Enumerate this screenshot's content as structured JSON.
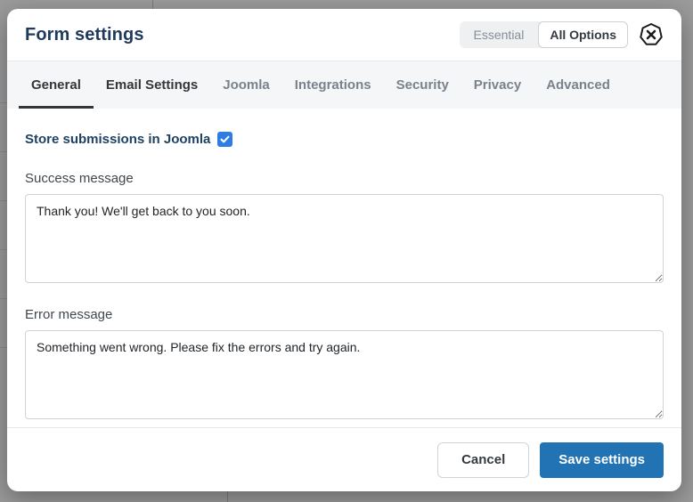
{
  "colors": {
    "accent_blue": "#2173b4",
    "checkbox_blue": "#2e7ce4",
    "title_navy": "#1f3a5c",
    "backdrop_gray": "#9b9b9b"
  },
  "modal": {
    "title": "Form settings",
    "mode_toggle": {
      "essential_label": "Essential",
      "all_options_label": "All Options",
      "selected": "All Options"
    },
    "logo_icon": "x-heptagon-icon",
    "tabs": [
      {
        "label": "General",
        "state": "active"
      },
      {
        "label": "Email Settings",
        "state": "emphasized"
      },
      {
        "label": "Joomla",
        "state": "normal"
      },
      {
        "label": "Integrations",
        "state": "normal"
      },
      {
        "label": "Security",
        "state": "normal"
      },
      {
        "label": "Privacy",
        "state": "normal"
      },
      {
        "label": "Advanced",
        "state": "normal"
      }
    ],
    "general_tab": {
      "store_submissions_label": "Store submissions in Joomla",
      "store_submissions_checked": true,
      "success_message_label": "Success message",
      "success_message_value": "Thank you! We'll get back to you soon.",
      "error_message_label": "Error message",
      "error_message_value": "Something went wrong. Please fix the errors and try again."
    },
    "footer": {
      "cancel_label": "Cancel",
      "save_label": "Save settings"
    }
  }
}
